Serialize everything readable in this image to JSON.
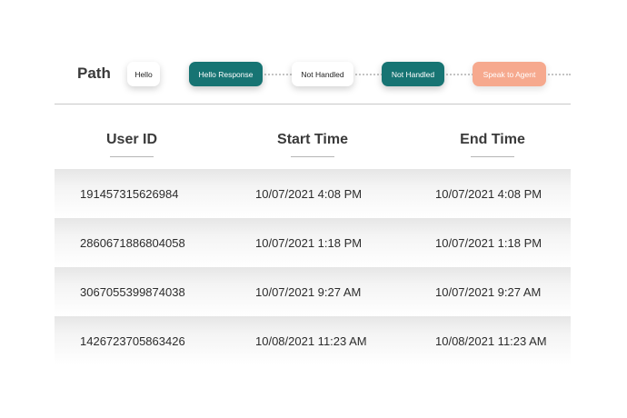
{
  "path": {
    "label": "Path",
    "steps": [
      {
        "label": "Hello",
        "style": "white"
      },
      {
        "label": "Hello Response",
        "style": "teal"
      },
      {
        "label": "Not Handled",
        "style": "white"
      },
      {
        "label": "Not Handled",
        "style": "teal"
      },
      {
        "label": "Speak to Agent",
        "style": "peach"
      }
    ]
  },
  "colors": {
    "teal": "#177473",
    "peach": "#f6a98e"
  },
  "table": {
    "columns": [
      "User ID",
      "Start Time",
      "End Time"
    ],
    "rows": [
      [
        "191457315626984",
        "10/07/2021 4:08 PM",
        "10/07/2021 4:08 PM"
      ],
      [
        "2860671886804058",
        "10/07/2021 1:18 PM",
        "10/07/2021 1:18 PM"
      ],
      [
        "3067055399874038",
        "10/07/2021 9:27 AM",
        "10/07/2021 9:27 AM"
      ],
      [
        "1426723705863426",
        "10/08/2021 11:23 AM",
        "10/08/2021 11:23 AM"
      ]
    ]
  }
}
